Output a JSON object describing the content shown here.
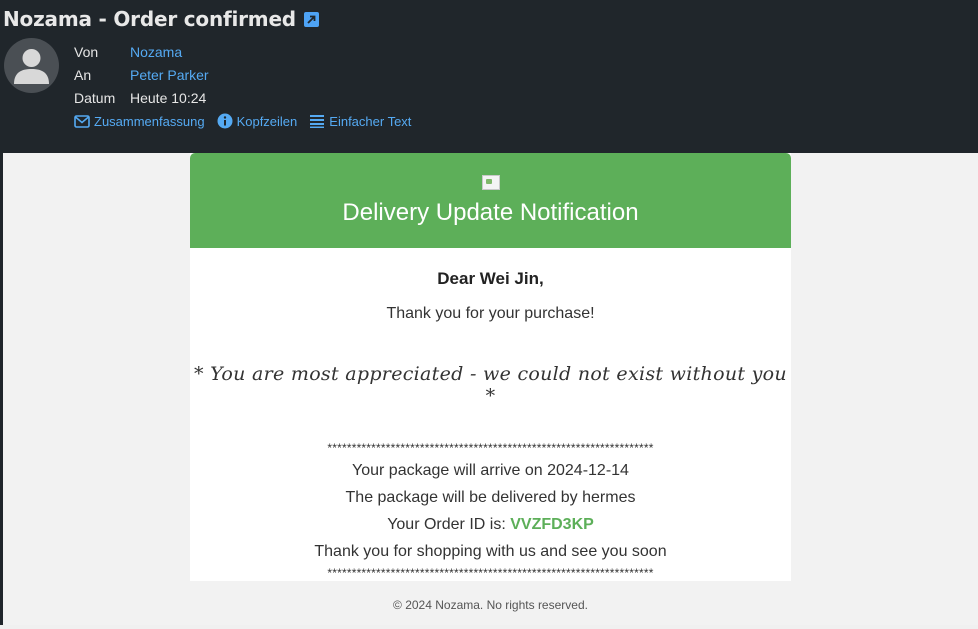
{
  "header": {
    "subject": "Nozama - Order confirmed",
    "fields": [
      {
        "label": "Von",
        "value": "Nozama"
      },
      {
        "label": "An",
        "value": "Peter Parker"
      },
      {
        "label": "Datum",
        "value": "Heute 10:24"
      }
    ],
    "views": [
      {
        "label": "Zusammenfassung",
        "icon": "envelope-icon"
      },
      {
        "label": "Kopfzeilen",
        "icon": "info-icon"
      },
      {
        "label": "Einfacher Text",
        "icon": "lines-icon"
      }
    ]
  },
  "email": {
    "banner_title": "Delivery Update Notification",
    "greeting": "Dear Wei Jin,",
    "thanks": "Thank you for your purchase!",
    "appreciated": "* You are most appreciated - we could not exist without you *",
    "separator": "*******************************************************************",
    "arrival_prefix": "Your package will arrive on",
    "arrival_date": "2024-12-14",
    "carrier_prefix": "The package will be delivered by",
    "carrier": "hermes",
    "order_id_prefix": "Your Order ID is:",
    "order_id": "VVZFD3KP",
    "closing": "Thank you for shopping with us and see you soon",
    "footer": "© 2024 Nozama. No rights reserved."
  },
  "colors": {
    "header_bg": "#20262b",
    "link": "#55aaf3",
    "banner_green": "#5daf59"
  }
}
